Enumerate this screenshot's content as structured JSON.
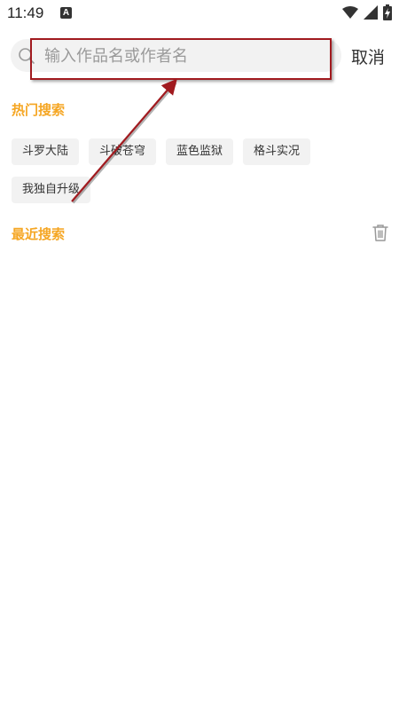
{
  "status_bar": {
    "time": "11:49",
    "notification_icon": "a-letter-icon",
    "wifi_icon": "wifi-icon",
    "signal_icon": "signal-icon",
    "battery_icon": "battery-charging-icon"
  },
  "search": {
    "placeholder": "输入作品名或作者名",
    "value": "",
    "icon": "search-icon",
    "cancel_label": "取消"
  },
  "hot_search": {
    "title": "热门搜索",
    "tags": [
      "斗罗大陆",
      "斗破苍穹",
      "蓝色监狱",
      "格斗实况",
      "我独自升级"
    ]
  },
  "recent_search": {
    "title": "最近搜索",
    "clear_icon": "trash-icon",
    "items": []
  },
  "colors": {
    "accent": "#f5a623",
    "annotation": "#a11a1f",
    "chip_bg": "#f2f2f2"
  }
}
